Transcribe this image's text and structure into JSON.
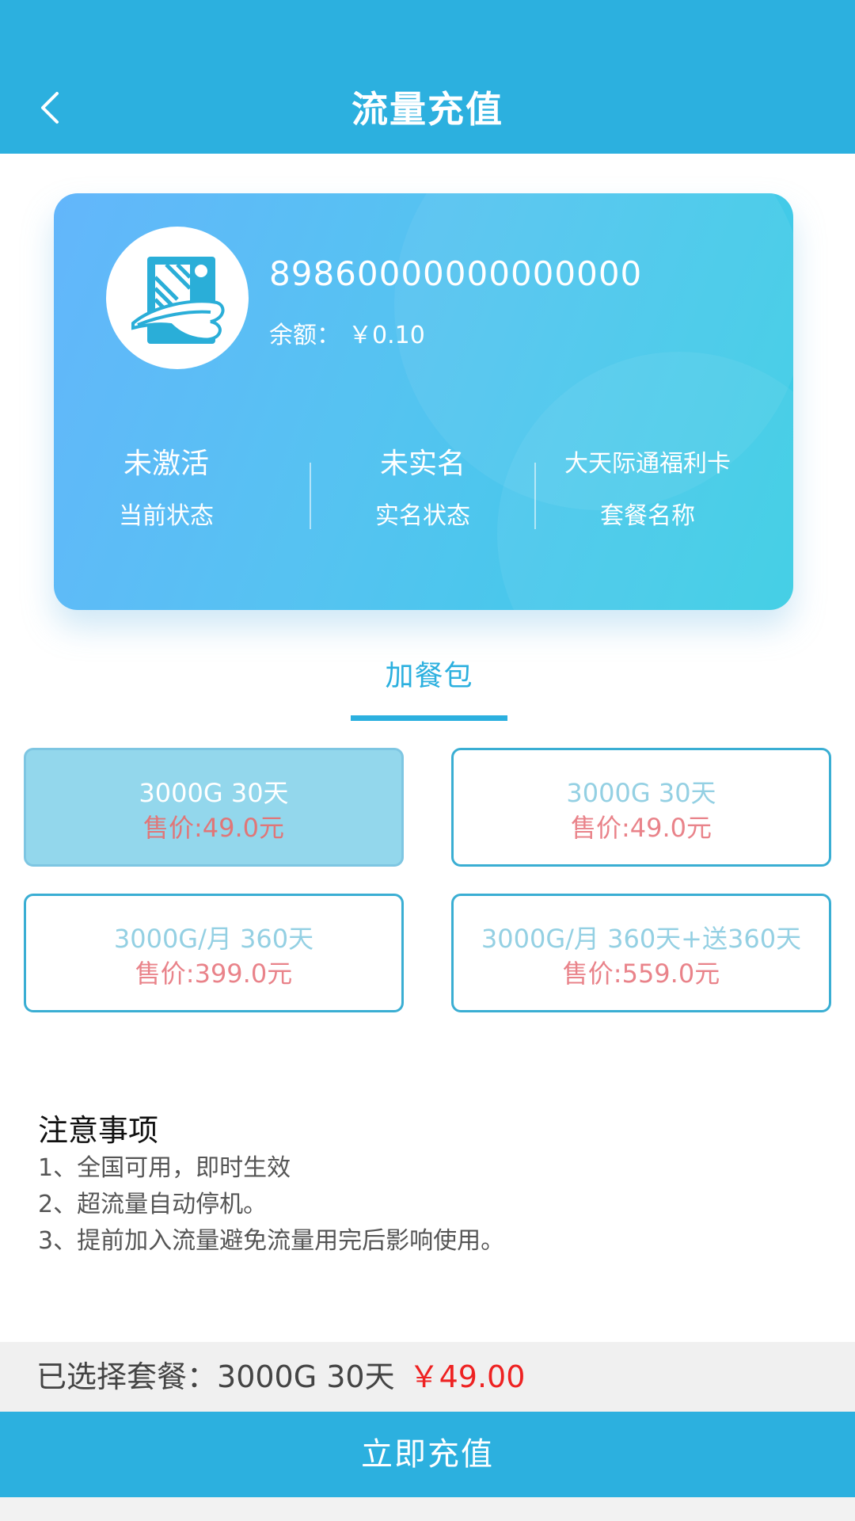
{
  "header": {
    "title": "流量充值",
    "back_icon": "chevron-left-icon"
  },
  "card": {
    "number": "89860000000000000",
    "balance_label": "余额：",
    "balance_value": "￥0.10",
    "stats": [
      {
        "value": "未激活",
        "label": "当前状态"
      },
      {
        "value": "未实名",
        "label": "实名状态"
      },
      {
        "value": "大天际通福利卡",
        "label": "套餐名称"
      }
    ]
  },
  "tab": {
    "label": "加餐包"
  },
  "packages": [
    {
      "name": "3000G 30天",
      "price": "售价:49.0元",
      "selected": true
    },
    {
      "name": "3000G 30天",
      "price": "售价:49.0元",
      "selected": false
    },
    {
      "name": "3000G/月 360天",
      "price": "售价:399.0元",
      "selected": false
    },
    {
      "name": "3000G/月 360天+送360天",
      "price": "售价:559.0元",
      "selected": false
    }
  ],
  "notes": {
    "title": "注意事项",
    "items": [
      "1、全国可用，即时生效",
      "2、超流量自动停机。",
      "3、提前加入流量避免流量用完后影响使用。"
    ]
  },
  "summary": {
    "label": "已选择套餐：",
    "package_name": "3000G 30天",
    "price": "￥49.00"
  },
  "action": {
    "recharge_label": "立即充值"
  },
  "colors": {
    "primary": "#2cb0df",
    "price_red": "#ee2222",
    "package_price": "#e9838a"
  }
}
